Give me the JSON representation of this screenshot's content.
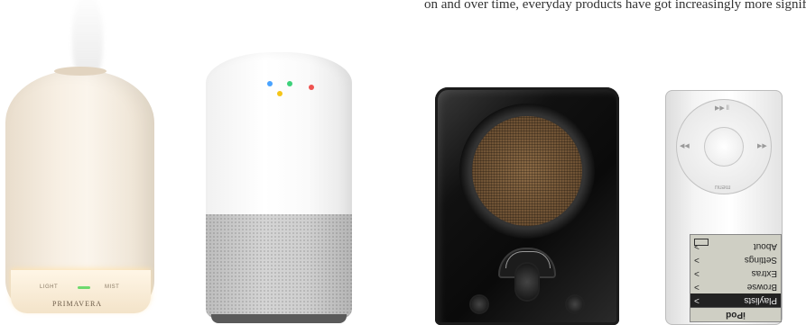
{
  "caption_fragment": "on and over time, everyday products have got increasingly more significant",
  "diffuser": {
    "brand": "PRIMAVERA",
    "label_left": "LIGHT",
    "label_right": "MIST",
    "led_color": "#6ed96e"
  },
  "speaker": {
    "dot_colors": [
      "#4aa3ff",
      "#3dd17a",
      "#f5c518",
      "#ef5350"
    ]
  },
  "ipod": {
    "wheel_top": "▶▶ ll",
    "wheel_bottom": "menu",
    "screen_title": "iPod",
    "menu_items": [
      "Playlists",
      "Browse",
      "Extras",
      "Settings",
      "About"
    ],
    "selected_index": 0
  }
}
